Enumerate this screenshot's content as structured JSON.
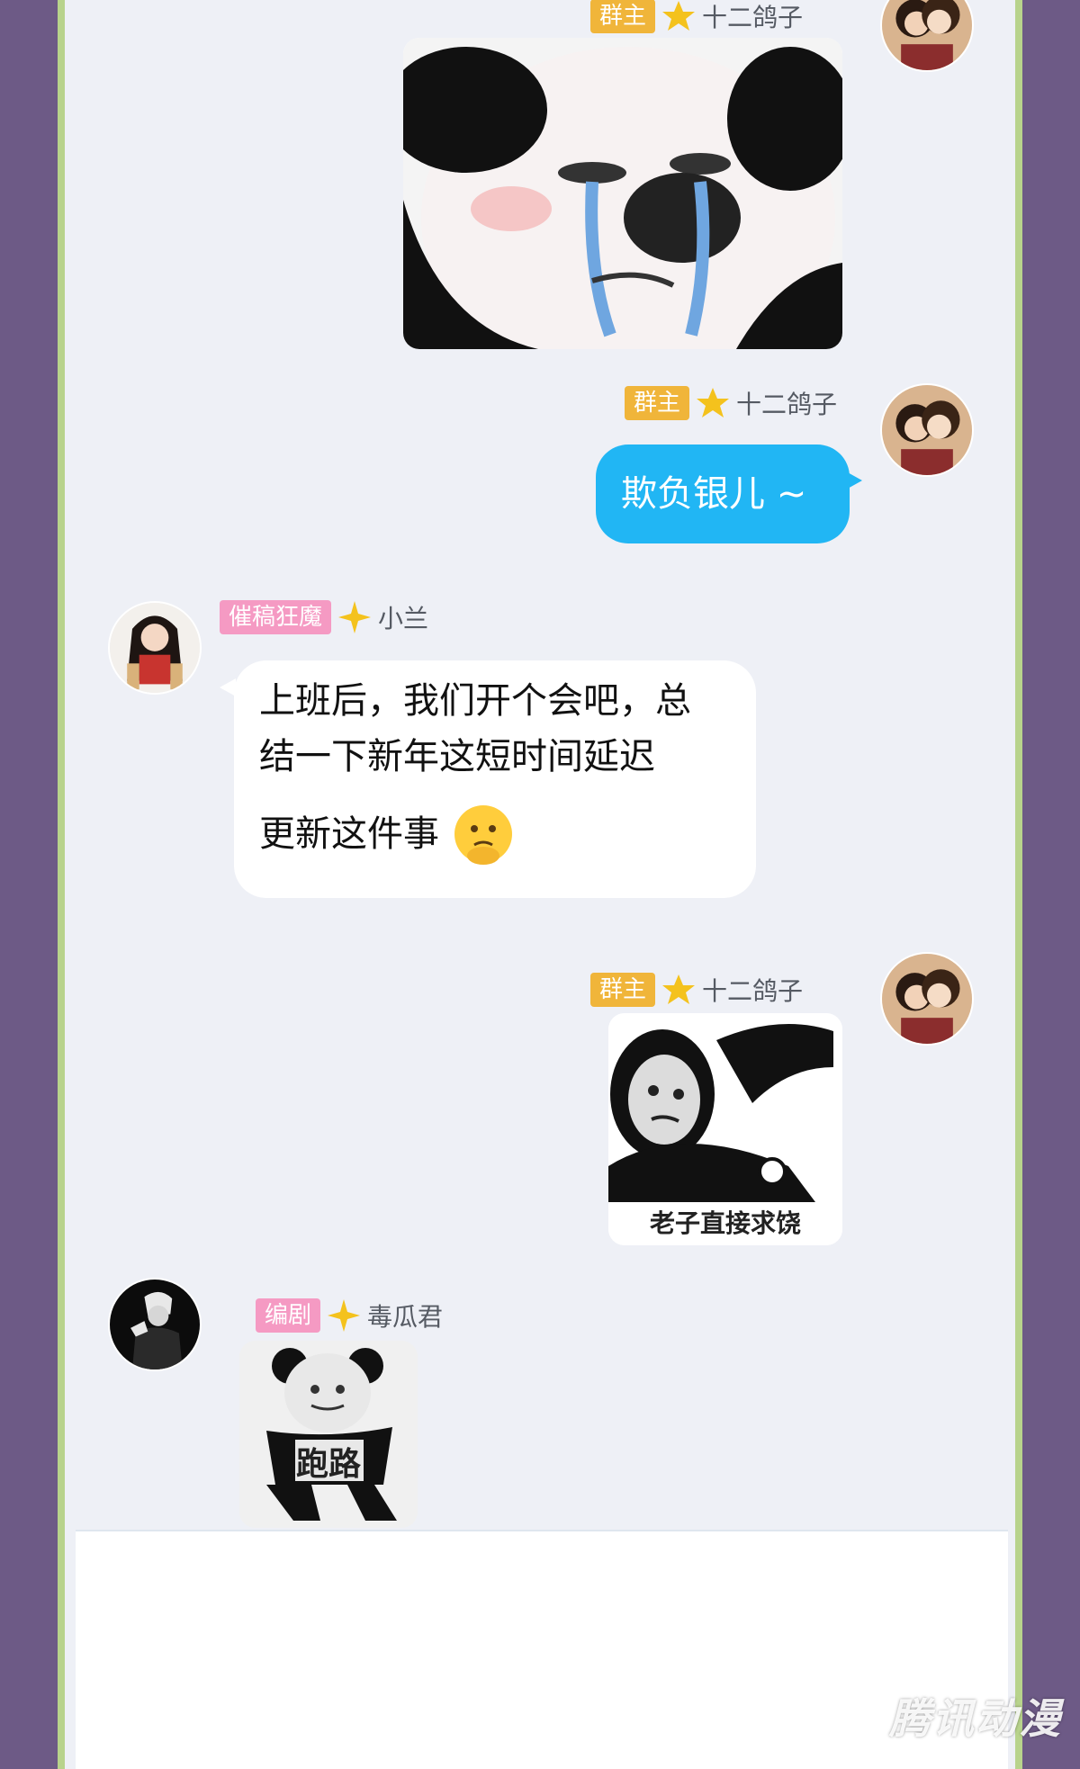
{
  "colors": {
    "frame_outer": "#6d5a86",
    "frame_border": "#b8d38c",
    "chat_background": "#eef0f6",
    "blue_bubble": "#21b6f4",
    "badge_owner": "#f0b53a",
    "badge_member": "#f59ac3"
  },
  "messages": [
    {
      "side": "right",
      "badge": "群主",
      "sender": "十二鸽子",
      "type": "sticker",
      "sticker_icon": "crying-panda-sticker"
    },
    {
      "side": "right",
      "badge": "群主",
      "sender": "十二鸽子",
      "type": "text",
      "text": "欺负银儿 ~"
    },
    {
      "side": "left",
      "badge": "催稿狂魔",
      "sender": "小兰",
      "type": "text",
      "lines": [
        "上班后，我们开个会吧，总",
        "结一下新年这短时间延迟",
        "更新这件事"
      ],
      "emoji_icon": "worried-face-emoji"
    },
    {
      "side": "right",
      "badge": "群主",
      "sender": "十二鸽子",
      "type": "sticker",
      "sticker_icon": "begging-panda-sticker",
      "caption": "老子直接求饶"
    },
    {
      "side": "left",
      "badge": "编剧",
      "sender": "毒瓜君",
      "type": "sticker",
      "sticker_icon": "running-panda-sticker",
      "caption": "跑路"
    }
  ],
  "watermark": "腾讯动漫"
}
